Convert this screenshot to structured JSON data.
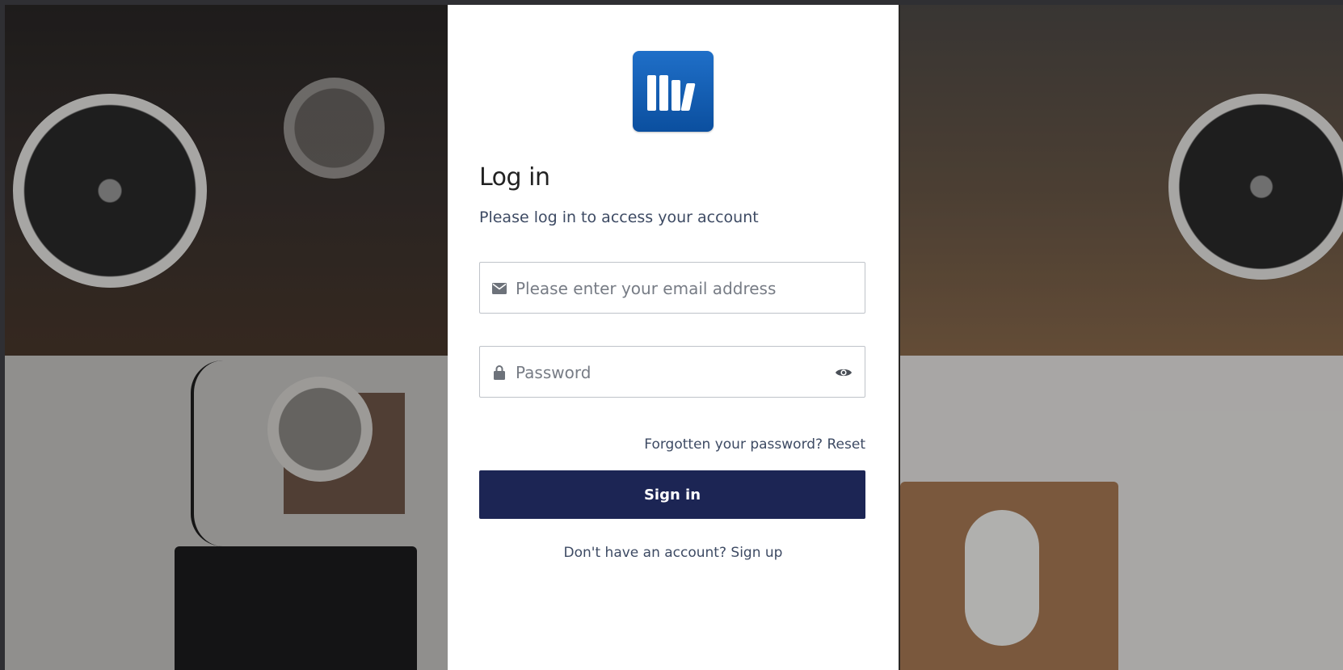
{
  "login": {
    "title": "Log in",
    "subtitle": "Please log in to access your account",
    "email_placeholder": "Please enter your email address",
    "password_placeholder": "Password",
    "forgot_prefix": "Forgotten your password?",
    "forgot_link": "Reset",
    "signin_label": "Sign in",
    "signup_prefix": "Don't have an account?",
    "signup_link": "Sign up"
  },
  "icons": {
    "logo": "books-logo-icon",
    "email": "envelope-icon",
    "password": "lock-icon",
    "show_password": "eye-icon"
  },
  "colors": {
    "primary_button": "#1c2554",
    "logo_blue": "#1565c0",
    "text_muted": "#3d4a63"
  }
}
